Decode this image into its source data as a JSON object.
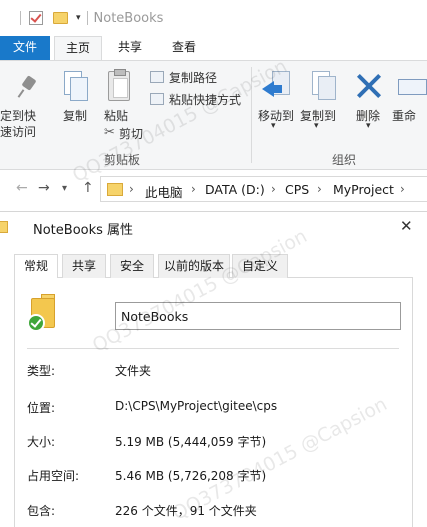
{
  "explorer": {
    "window_title": "NoteBooks",
    "ribbon_tabs": {
      "file": "文件",
      "home": "主页",
      "share": "共享",
      "view": "查看"
    },
    "clipboard": {
      "pin_line1": "定到快",
      "pin_line2": "速访问",
      "copy": "复制",
      "paste": "粘贴",
      "copy_path": "复制路径",
      "paste_shortcut": "粘贴快捷方式",
      "cut": "剪切",
      "group_label": "剪贴板"
    },
    "organize": {
      "move_to": "移动到",
      "copy_to": "复制到",
      "delete": "删除",
      "rename": "重命",
      "group_label": "组织"
    },
    "address": {
      "crumbs": [
        "此电脑",
        "DATA (D:)",
        "CPS",
        "MyProject"
      ]
    }
  },
  "dialog": {
    "title": "NoteBooks 属性",
    "close_glyph": "✕",
    "tabs": [
      "常规",
      "共享",
      "安全",
      "以前的版本",
      "自定义"
    ],
    "name_value": "NoteBooks",
    "rows": [
      {
        "label": "类型:",
        "value": "文件夹"
      },
      {
        "label": "位置:",
        "value": "D:\\CPS\\MyProject\\gitee\\cps"
      },
      {
        "label": "大小:",
        "value": "5.19 MB (5,444,059 字节)"
      },
      {
        "label": "占用空间:",
        "value": "5.46 MB (5,726,208 字节)"
      },
      {
        "label": "包含:",
        "value": "226 个文件，91 个文件夹"
      }
    ]
  },
  "watermark": "QQ373704015 @Capsion"
}
